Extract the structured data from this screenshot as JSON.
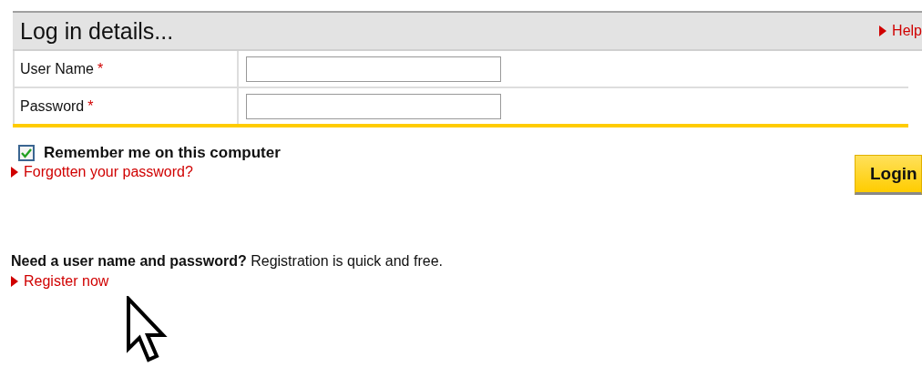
{
  "panel": {
    "title": "Log in details...",
    "help_link": "Help"
  },
  "fields": [
    {
      "label": "User Name",
      "required_mark": "*"
    },
    {
      "label": "Password",
      "required_mark": "*"
    }
  ],
  "remember": {
    "label": "Remember me on this computer",
    "checked": true
  },
  "forgot_link": "Forgotten your password?",
  "login_button": "Login",
  "register": {
    "text": "**Need a user name and password?** Registration is quick and free.",
    "link": "Register now"
  }
}
